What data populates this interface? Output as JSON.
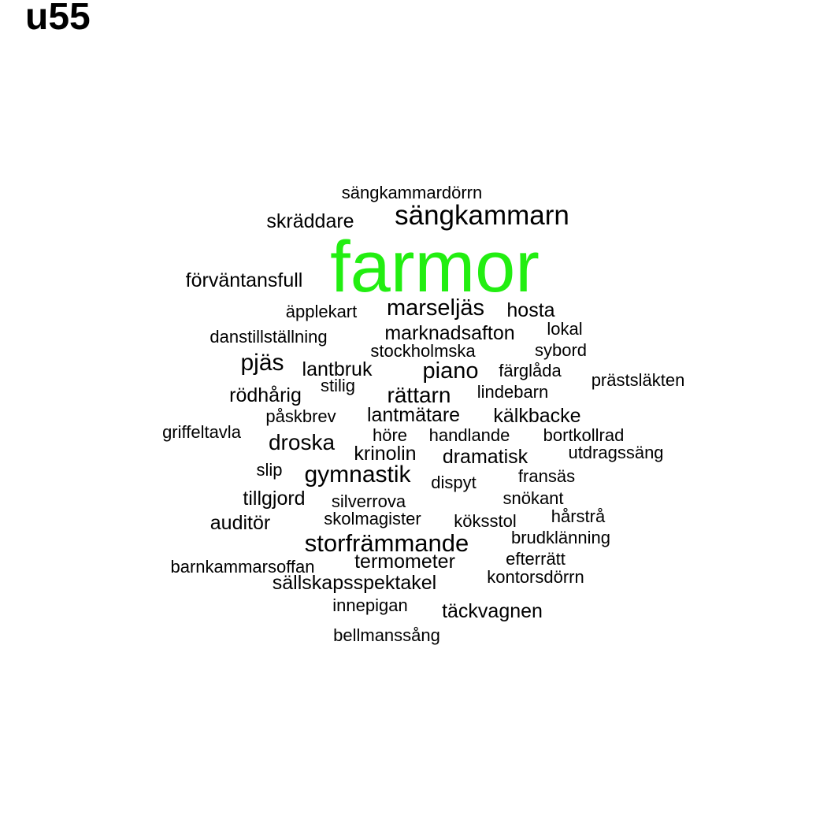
{
  "title": "u55",
  "colors": {
    "top_word": "#22ee11",
    "word": "#000000",
    "background": "#ffffff"
  },
  "chart_data": {
    "type": "wordcloud",
    "title": "u55",
    "words": [
      {
        "text": "farmor",
        "weight": 10
      },
      {
        "text": "sängkammarn",
        "weight": 3
      },
      {
        "text": "storfrämmande",
        "weight": 3
      },
      {
        "text": "marseljäs",
        "weight": 3
      },
      {
        "text": "gymnastik",
        "weight": 3
      },
      {
        "text": "pjäs",
        "weight": 3
      },
      {
        "text": "piano",
        "weight": 3
      },
      {
        "text": "rättarn",
        "weight": 3
      },
      {
        "text": "droska",
        "weight": 3
      },
      {
        "text": "skräddare",
        "weight": 2
      },
      {
        "text": "förväntansfull",
        "weight": 2
      },
      {
        "text": "hosta",
        "weight": 2
      },
      {
        "text": "marknadsafton",
        "weight": 2
      },
      {
        "text": "lantbruk",
        "weight": 2
      },
      {
        "text": "rödhårig",
        "weight": 2
      },
      {
        "text": "kälkbacke",
        "weight": 2
      },
      {
        "text": "lantmätare",
        "weight": 2
      },
      {
        "text": "krinolin",
        "weight": 2
      },
      {
        "text": "dramatisk",
        "weight": 2
      },
      {
        "text": "tillgjord",
        "weight": 2
      },
      {
        "text": "auditör",
        "weight": 2
      },
      {
        "text": "termometer",
        "weight": 2
      },
      {
        "text": "sällskapsspektakel",
        "weight": 2
      },
      {
        "text": "täckvagnen",
        "weight": 2
      },
      {
        "text": "sängkammardörrn",
        "weight": 1
      },
      {
        "text": "äpplekart",
        "weight": 1
      },
      {
        "text": "danstillställning",
        "weight": 1
      },
      {
        "text": "lokal",
        "weight": 1
      },
      {
        "text": "stockholmska",
        "weight": 1
      },
      {
        "text": "sybord",
        "weight": 1
      },
      {
        "text": "färglåda",
        "weight": 1
      },
      {
        "text": "prästsläkten",
        "weight": 1
      },
      {
        "text": "stilig",
        "weight": 1
      },
      {
        "text": "lindebarn",
        "weight": 1
      },
      {
        "text": "påskbrev",
        "weight": 1
      },
      {
        "text": "griffeltavla",
        "weight": 1
      },
      {
        "text": "höre",
        "weight": 1
      },
      {
        "text": "handlande",
        "weight": 1
      },
      {
        "text": "bortkollrad",
        "weight": 1
      },
      {
        "text": "utdragssäng",
        "weight": 1
      },
      {
        "text": "slip",
        "weight": 1
      },
      {
        "text": "dispyt",
        "weight": 1
      },
      {
        "text": "fransäs",
        "weight": 1
      },
      {
        "text": "silverrova",
        "weight": 1
      },
      {
        "text": "snökant",
        "weight": 1
      },
      {
        "text": "skolmagister",
        "weight": 1
      },
      {
        "text": "köksstol",
        "weight": 1
      },
      {
        "text": "hårstrå",
        "weight": 1
      },
      {
        "text": "brudklänning",
        "weight": 1
      },
      {
        "text": "barnkammarsoffan",
        "weight": 1
      },
      {
        "text": "efterrätt",
        "weight": 1
      },
      {
        "text": "kontorsdörrn",
        "weight": 1
      },
      {
        "text": "innepigan",
        "weight": 1
      },
      {
        "text": "bellmanssång",
        "weight": 1
      }
    ]
  }
}
